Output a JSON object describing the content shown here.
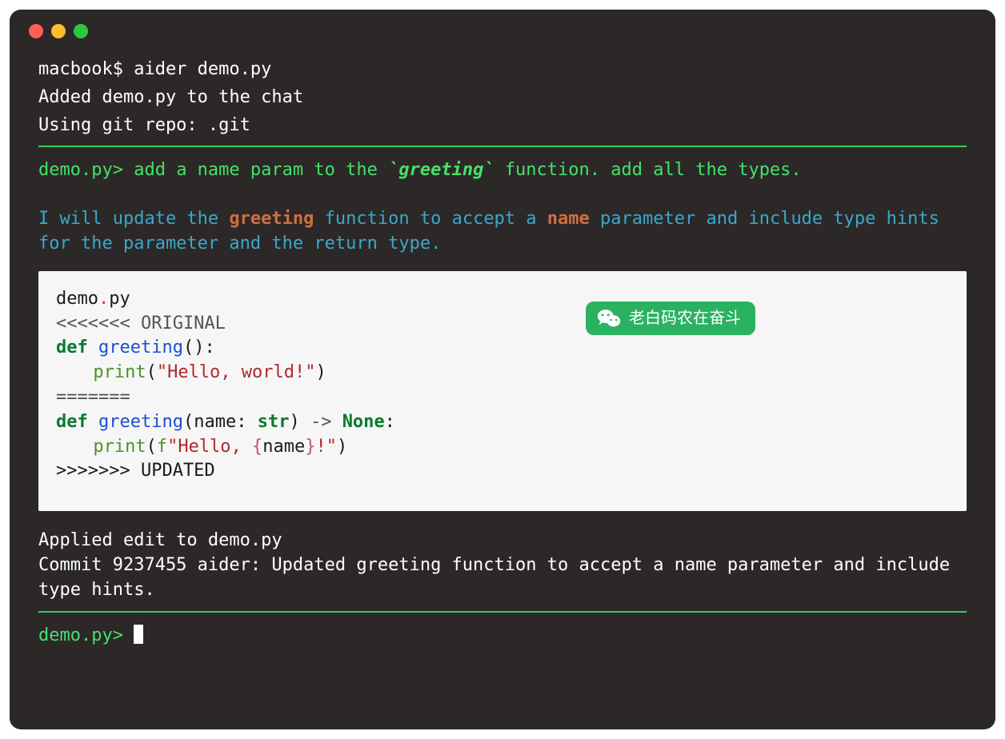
{
  "header": {
    "shell_line": "macbook$ aider demo.py",
    "added_line": "Added demo.py to the chat",
    "git_line": "Using git repo: .git"
  },
  "prompt1": {
    "prefix": "demo.py>",
    "pre": " add a name param to the ",
    "code": "`greeting`",
    "post": " function. add all the types."
  },
  "ai": {
    "p1a": "I will update the ",
    "p1b": "greeting",
    "p1c": " function to accept a ",
    "p1d": "name",
    "p1e": " parameter and include type hints for the parameter and the return type."
  },
  "code": {
    "filename_a": "demo",
    "filename_dot": ".",
    "filename_b": "py",
    "mark_orig": "<<<<<<< ORIGINAL",
    "def": "def",
    "fn": "greeting",
    "lparen": "(",
    "rparen": ")",
    "colon": ":",
    "print": "print",
    "str_hello_world": "\"Hello, world!\"",
    "mark_sep": "=======",
    "param_name": "name",
    "type_str": "str",
    "arrow": " -> ",
    "none": "None",
    "fprefix": "f",
    "str_open": "\"Hello, ",
    "lbrace": "{",
    "rbrace": "}",
    "str_close_excl": "!\"",
    "mark_upd": ">>>>>>> UPDATED"
  },
  "footer": {
    "applied": "Applied edit to demo.py",
    "commit": "Commit 9237455 aider: Updated greeting function to accept a name parameter and include type hints."
  },
  "prompt2": {
    "prefix": "demo.py>"
  },
  "badge": {
    "text": "老白码农在奋斗"
  }
}
